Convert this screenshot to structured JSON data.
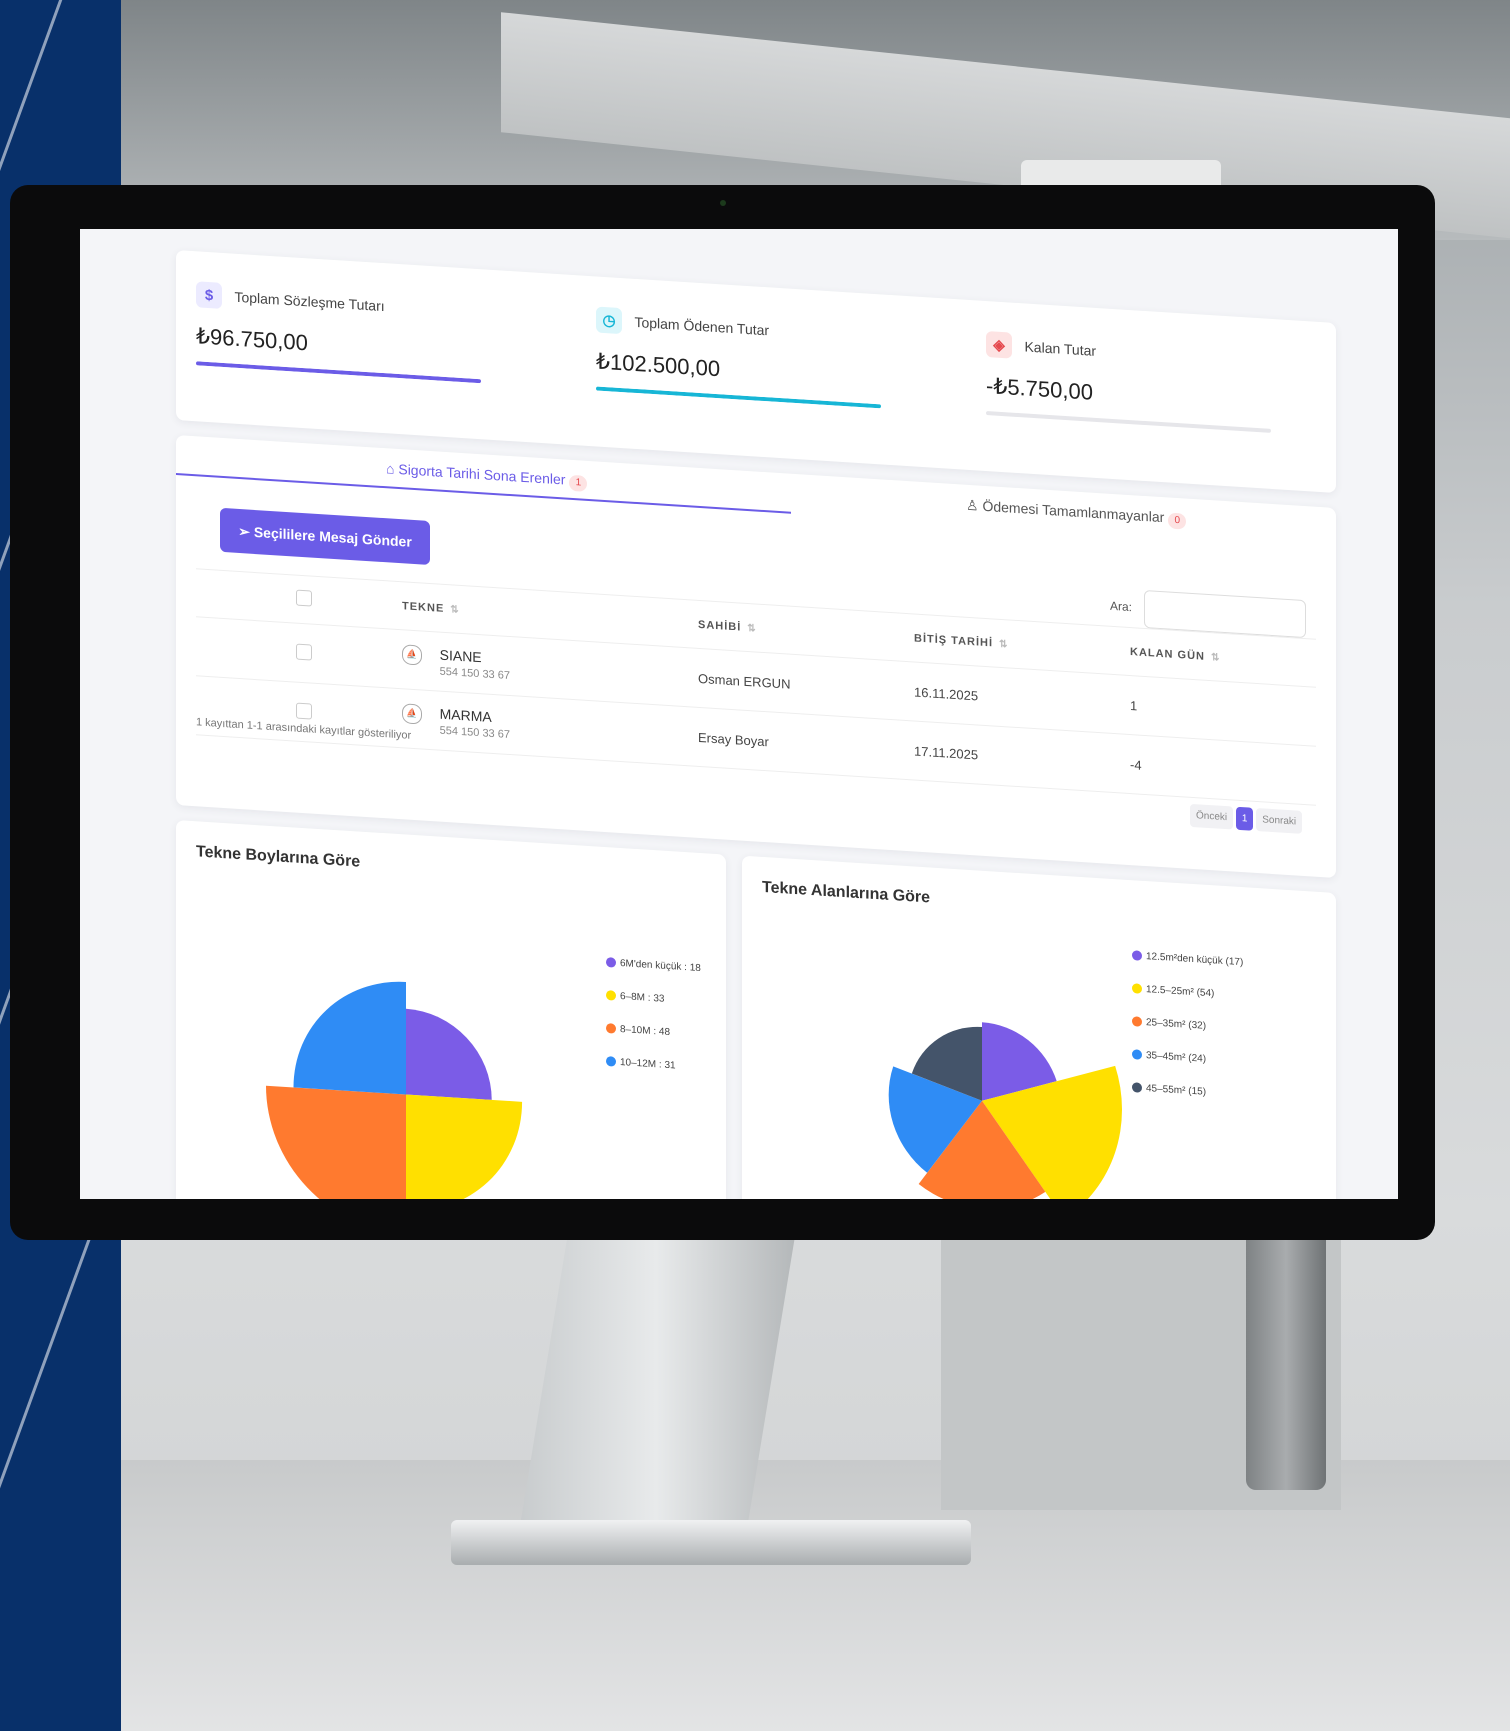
{
  "stats": [
    {
      "label": "Toplam Sözleşme Tutarı",
      "value": "₺96.750,00",
      "icon": "dollar-icon",
      "color": "#6b5ce7",
      "bar": 1.0
    },
    {
      "label": "Toplam Ödenen Tutar",
      "value": "₺102.500,00",
      "icon": "clock-icon",
      "color": "#17b6d6",
      "bar": 1.0
    },
    {
      "label": "Kalan Tutar",
      "value": "-₺5.750,00",
      "icon": "wallet-icon",
      "color": "#e5484d",
      "bar": 0.0
    }
  ],
  "tabs": [
    {
      "label": "Sigorta Tarihi Sona Erenler",
      "count": "1",
      "active": true
    },
    {
      "label": "Ödemesi Tamamlanmayanlar",
      "count": "0",
      "active": false
    }
  ],
  "send_button": "Seçililere Mesaj Gönder",
  "search_label": "Ara:",
  "table": {
    "headers": [
      "TEKNE",
      "SAHİBİ",
      "BİTİŞ TARİHİ",
      "KALAN GÜN"
    ],
    "rows": [
      {
        "name": "SIANE",
        "phone": "554 150 33 67",
        "owner": "Osman ERGUN",
        "end": "16.11.2025",
        "left": "1"
      },
      {
        "name": "MARMA",
        "phone": "554 150 33 67",
        "owner": "Ersay Boyar",
        "end": "17.11.2025",
        "left": "-4"
      }
    ]
  },
  "info": "1 kayıttan 1-1 arasındaki kayıtlar gösteriliyor",
  "pager": {
    "prev": "Önceki",
    "page": "1",
    "next": "Sonraki"
  },
  "chart_data": [
    {
      "type": "pie",
      "title": "Tekne Boylarına Göre",
      "categories": [
        "6M'den küçük",
        "6–8M",
        "8–10M",
        "10–12M"
      ],
      "values": [
        18,
        33,
        48,
        31
      ],
      "legend_labels": [
        "6M'den küçük : 18",
        "6–8M : 33",
        "8–10M : 48",
        "10–12M : 31"
      ],
      "colors": [
        "#7b5ce7",
        "#ffe000",
        "#ff7a2f",
        "#2f8cf5"
      ]
    },
    {
      "type": "pie",
      "title": "Tekne Alanlarına Göre",
      "categories": [
        "12.5m²den küçük",
        "12.5–25m²",
        "25–35m²",
        "35–45m²",
        "45–55m²"
      ],
      "values": [
        17,
        54,
        32,
        24,
        15
      ],
      "legend_labels": [
        "12.5m²den küçük (17)",
        "12.5–25m² (54)",
        "25–35m² (32)",
        "35–45m² (24)",
        "45–55m² (15)"
      ],
      "colors": [
        "#7b5ce7",
        "#ffe000",
        "#ff7a2f",
        "#2f8cf5",
        "#44546a"
      ]
    }
  ]
}
